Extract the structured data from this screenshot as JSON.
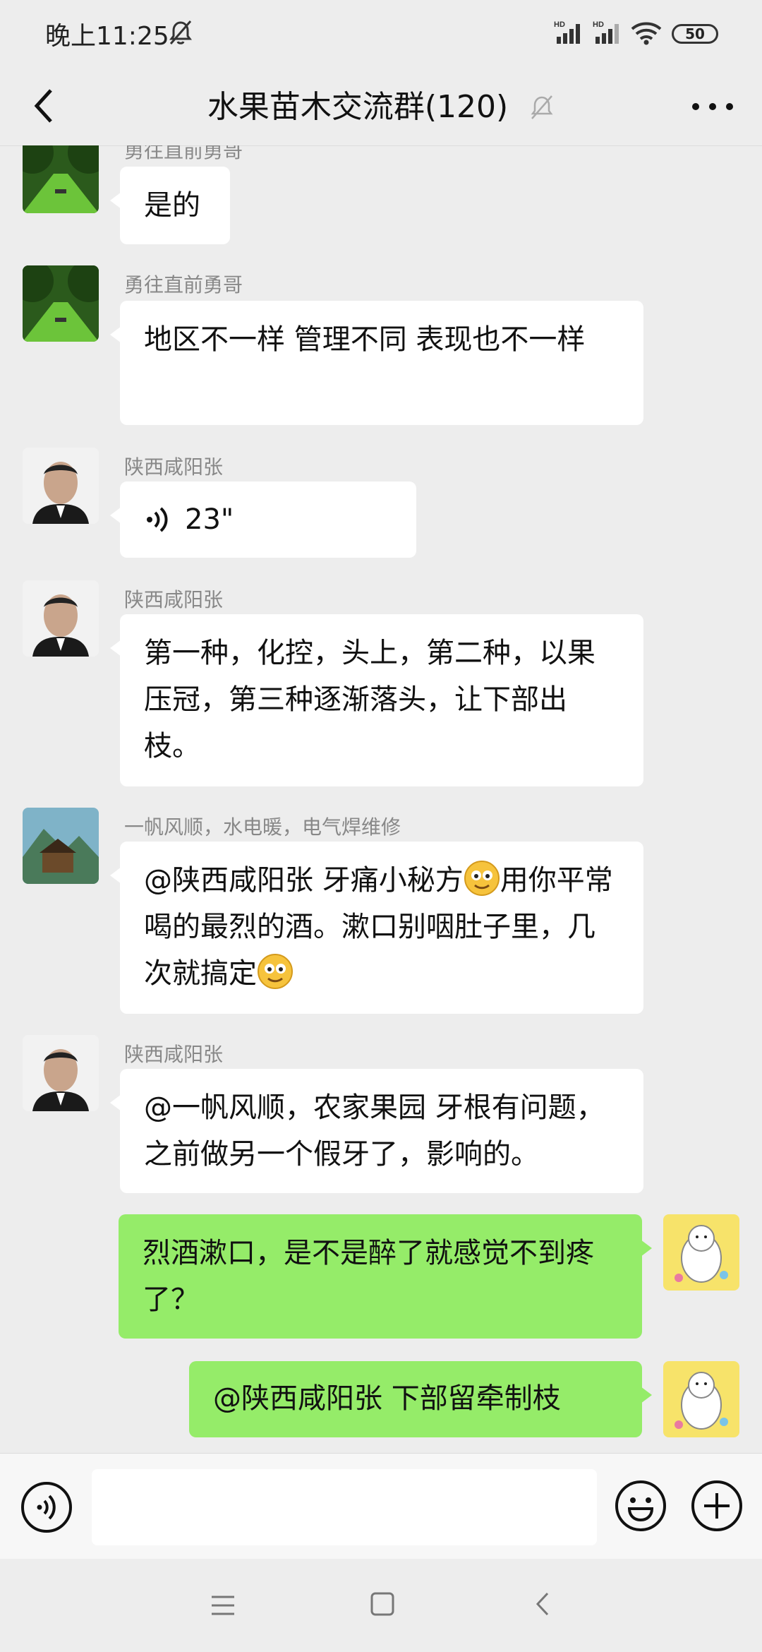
{
  "status_bar": {
    "time": "晚上11:25",
    "battery": "50",
    "signal_label_1": "HD",
    "signal_label_2": "HD"
  },
  "header": {
    "title": "水果苗木交流群(120)"
  },
  "messages": [
    {
      "sender": "勇往直前勇哥",
      "text": "是的"
    },
    {
      "sender": "勇往直前勇哥",
      "text": "地区不一样 管理不同 表现也不一样"
    },
    {
      "sender": "陕西咸阳张",
      "type": "voice",
      "duration": "23\""
    },
    {
      "sender": "陕西咸阳张",
      "text": "第一种，化控，头上，第二种，以果压冠，第三种逐渐落头，让下部出枝。"
    },
    {
      "sender": "一帆风顺，水电暖，电气焊维修",
      "text_parts": [
        "@陕西咸阳张  牙痛小秘方",
        "用你平常喝的最烈的酒。漱口别咽肚子里，几次就搞定"
      ]
    },
    {
      "sender": "陕西咸阳张",
      "text": "@一帆风顺，农家果园  牙根有问题，之前做另一个假牙了，影响的。"
    },
    {
      "sender": "me",
      "text": "烈酒漱口，是不是醉了就感觉不到疼了？"
    },
    {
      "sender": "me",
      "text": "@陕西咸阳张  下部留牵制枝"
    }
  ],
  "input": {
    "value": ""
  },
  "colors": {
    "my_bubble": "#95ec69",
    "other_bubble": "#ffffff",
    "background": "#ededed"
  },
  "icons": [
    "back-arrow-icon",
    "bell-muted-icon",
    "more-icon",
    "voice-input-icon",
    "emoji-icon",
    "plus-icon",
    "menu-nav-icon",
    "home-nav-icon",
    "back-nav-icon"
  ]
}
